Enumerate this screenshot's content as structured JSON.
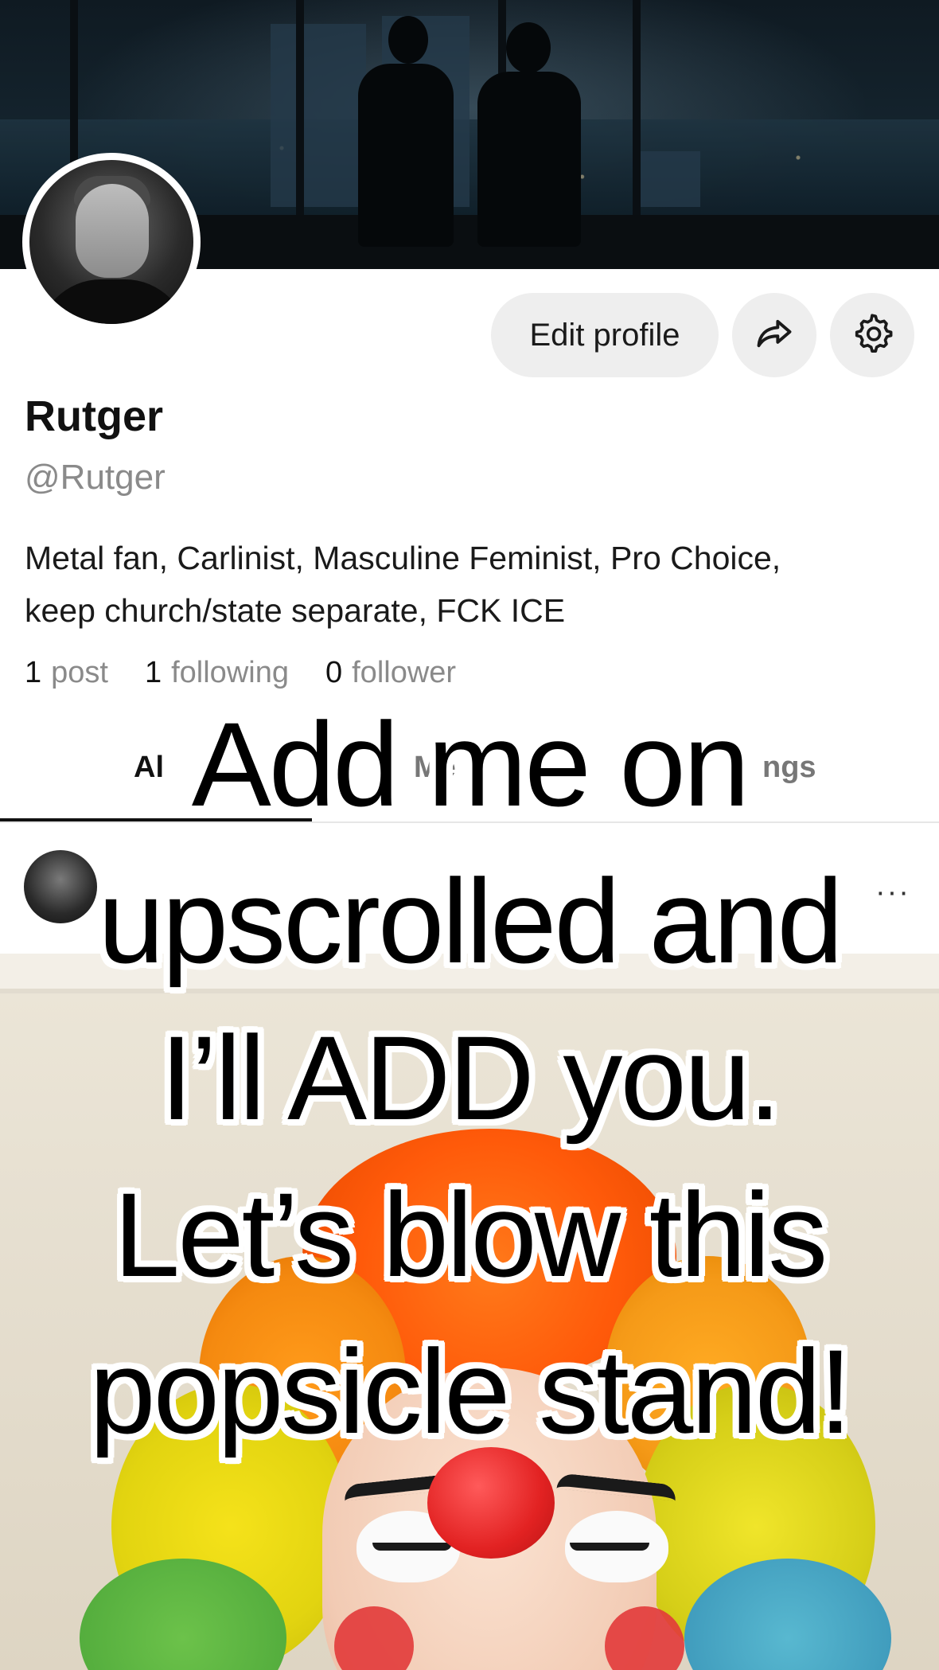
{
  "profile": {
    "name": "Rutger",
    "handle": "@Rutger",
    "bio": "Metal fan, Carlinist, Masculine Feminist, Pro Choice, keep church/state separate, FCK ICE"
  },
  "actions": {
    "edit_label": "Edit profile",
    "share_icon": "share-arrow-icon",
    "settings_icon": "gear-icon"
  },
  "stats": [
    {
      "num": "1",
      "label": "post"
    },
    {
      "num": "1",
      "label": "following"
    },
    {
      "num": "0",
      "label": "follower"
    }
  ],
  "tabs": {
    "left_partial": "Al",
    "middle_partial": "Me",
    "right_partial": "ngs"
  },
  "post_row": {
    "more_label": "···"
  },
  "overlay_caption": {
    "lines": [
      "Add me on",
      "upscrolled and",
      "I’ll ADD you.",
      "Let’s blow this",
      "popsicle stand!"
    ]
  },
  "colors": {
    "button_bg": "#eeeeee",
    "text_muted": "#8a8a8a",
    "clown_nose": "#e22222"
  }
}
